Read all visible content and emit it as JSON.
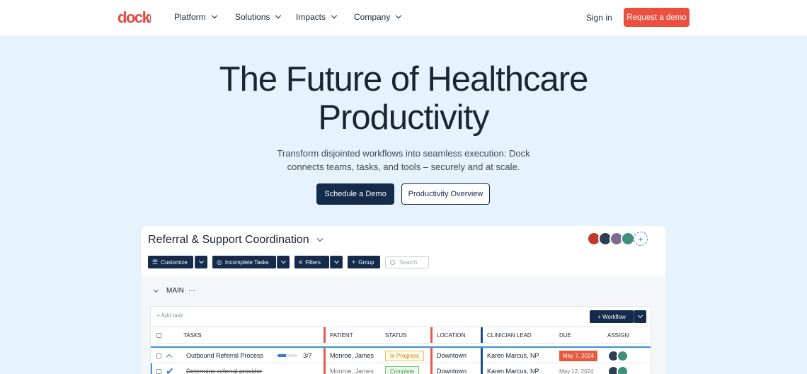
{
  "nav": {
    "logo": "dock",
    "items": [
      {
        "label": "Platform"
      },
      {
        "label": "Solutions"
      },
      {
        "label": "Impacts"
      },
      {
        "label": "Company"
      }
    ],
    "signin": "Sign in",
    "request_demo": "Request a demo"
  },
  "hero": {
    "title_line1": "The Future of Healthcare",
    "title_line2": "Productivity",
    "subtitle_line1": "Transform disjointed workflows into seamless execution: Dock",
    "subtitle_line2": "connects teams, tasks, and tools – securely and at scale.",
    "primary_cta": "Schedule a Demo",
    "secondary_cta": "Productivity Overview"
  },
  "app": {
    "title": "Referral & Support Coordination",
    "avatar_add": "+",
    "toolbar": {
      "customize": "Customize",
      "incomplete": "Incomplete Tasks",
      "filters": "Filters",
      "group": "Group",
      "search_placeholder": "Search"
    },
    "group_label": "MAIN",
    "group_dots": "···",
    "add_task": "+ Add task",
    "workflow": "+ Workflow",
    "columns": {
      "tasks": "TASKS",
      "patient": "PATIENT",
      "status": "STATUS",
      "location": "LOCATION",
      "clinician": "CLINICIAN LEAD",
      "due": "DUE",
      "assign": "ASSIGN"
    },
    "rows": [
      {
        "task": "Outbound Referral Process",
        "progress_text": "3/7",
        "progress": 0.43,
        "patient": "Monroe, James",
        "status": "In Progress",
        "location": "Downtown",
        "clinician": "Karen Marcus, NP",
        "due": "May 7, 2024"
      },
      {
        "task": "Determine referral provider",
        "patient": "Monroe, James",
        "status": "Complete",
        "location": "Downtown",
        "clinician": "Karen Marcus, NP",
        "due": "May 12, 2024"
      }
    ]
  },
  "colors": {
    "brand": "#e8473b",
    "navy": "#142b4c",
    "hero_bg": "#e6f3fd"
  }
}
